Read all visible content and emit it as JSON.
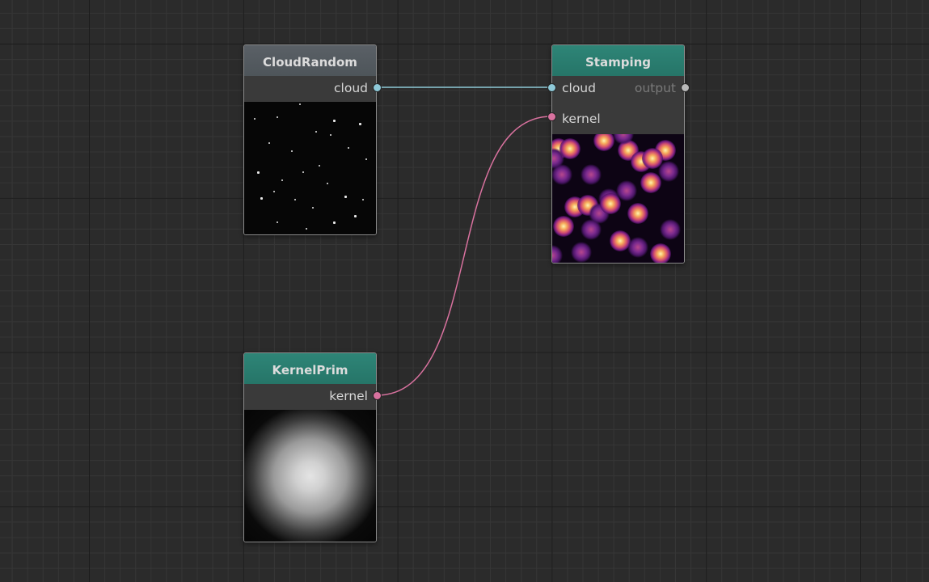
{
  "colors": {
    "cloud_wire": "#8ec9d8",
    "kernel_wire": "#d9729f",
    "output_port": "#b8b8b8"
  },
  "nodes": {
    "cloud_random": {
      "title": "CloudRandom",
      "output_label": "cloud",
      "preview": "point-cloud"
    },
    "stamping": {
      "title": "Stamping",
      "input_cloud_label": "cloud",
      "input_kernel_label": "kernel",
      "output_label": "output",
      "preview": "stamped-kernels"
    },
    "kernel_prim": {
      "title": "KernelPrim",
      "output_label": "kernel",
      "preview": "gaussian-kernel"
    }
  },
  "connections": [
    {
      "from": "CloudRandom.cloud",
      "to": "Stamping.cloud"
    },
    {
      "from": "KernelPrim.kernel",
      "to": "Stamping.kernel"
    }
  ]
}
